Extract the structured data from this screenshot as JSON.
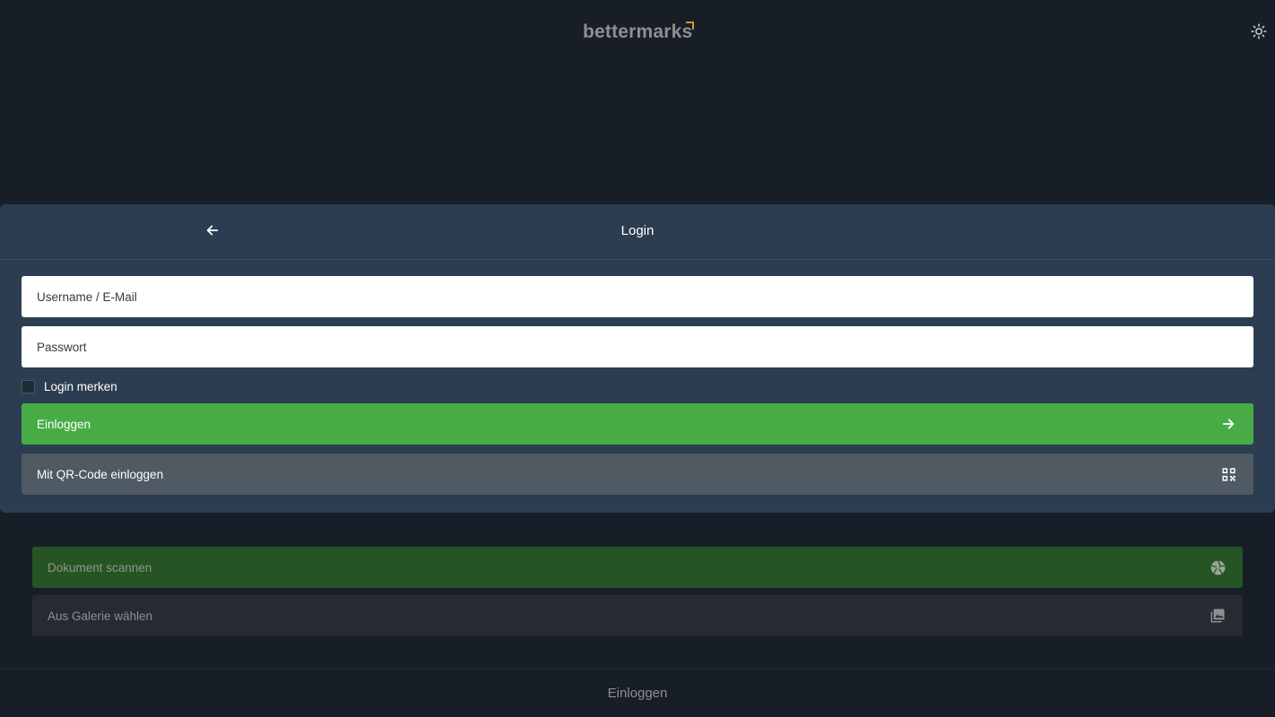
{
  "header": {
    "logo_text": "bettermarks",
    "theme_icon": "sun-icon",
    "brand_accent": "#d29a1e"
  },
  "login_sheet": {
    "title": "Login",
    "back_icon": "arrow-left-icon",
    "username_placeholder": "Username / E-Mail",
    "username_value": "",
    "password_placeholder": "Passwort",
    "password_value": "",
    "remember_label": "Login merken",
    "remember_checked": false,
    "login_button_label": "Einloggen",
    "login_button_icon": "arrow-right-icon",
    "login_button_color": "#48ac46",
    "qr_button_label": "Mit QR-Code einloggen",
    "qr_button_icon": "qr-code-icon"
  },
  "background_actions": {
    "scan_label": "Dokument scannen",
    "scan_icon": "camera-shutter-icon",
    "gallery_label": "Aus Galerie wählen",
    "gallery_icon": "gallery-icon"
  },
  "footer": {
    "label": "Einloggen"
  }
}
